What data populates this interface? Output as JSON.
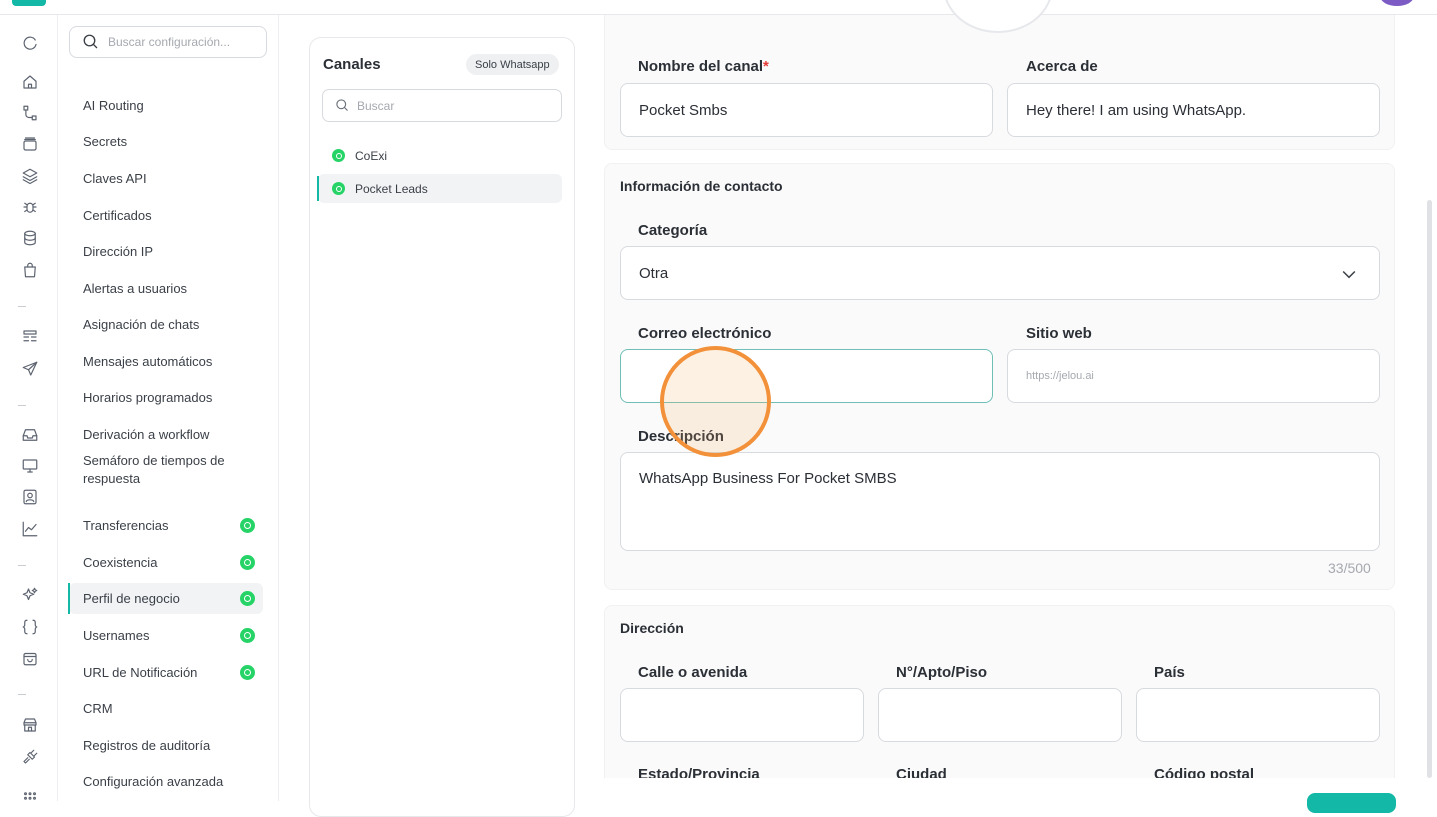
{
  "settings_nav": {
    "search_placeholder": "Buscar configuración...",
    "items": [
      {
        "label": "AI Routing",
        "whatsapp": false
      },
      {
        "label": "Secrets",
        "whatsapp": false
      },
      {
        "label": "Claves API",
        "whatsapp": false
      },
      {
        "label": "Certificados",
        "whatsapp": false
      },
      {
        "label": "Dirección IP",
        "whatsapp": false
      },
      {
        "label": "Alertas a usuarios",
        "whatsapp": false
      },
      {
        "label": "Asignación de chats",
        "whatsapp": false
      },
      {
        "label": "Mensajes automáticos",
        "whatsapp": false
      },
      {
        "label": "Horarios programados",
        "whatsapp": false
      },
      {
        "label": "Derivación a workflow",
        "whatsapp": false
      },
      {
        "label": "Semáforo de tiempos de respuesta",
        "whatsapp": false
      },
      {
        "label": "Transferencias",
        "whatsapp": true
      },
      {
        "label": "Coexistencia",
        "whatsapp": true
      },
      {
        "label": "Perfil de negocio",
        "whatsapp": true,
        "active": true
      },
      {
        "label": "Usernames",
        "whatsapp": true
      },
      {
        "label": "URL de Notificación",
        "whatsapp": true
      },
      {
        "label": "CRM",
        "whatsapp": false
      },
      {
        "label": "Registros de auditoría",
        "whatsapp": false
      },
      {
        "label": "Configuración avanzada",
        "whatsapp": false
      }
    ]
  },
  "channels": {
    "title": "Canales",
    "badge": "Solo Whatsapp",
    "search_placeholder": "Buscar",
    "items": [
      {
        "label": "CoExi"
      },
      {
        "label": "Pocket Leads",
        "active": true
      }
    ]
  },
  "profile": {
    "channel_name_label": "Nombre del canal",
    "required_mark": "*",
    "channel_name_value": "Pocket Smbs",
    "about_label": "Acerca de",
    "about_value": "Hey there! I am using WhatsApp."
  },
  "contact": {
    "title": "Información de contacto",
    "category_label": "Categoría",
    "category_value": "Otra",
    "email_label": "Correo electrónico",
    "email_value": "",
    "website_label": "Sitio web",
    "website_placeholder": "https://jelou.ai",
    "description_label": "Descripción",
    "description_value": "WhatsApp Business For Pocket SMBS",
    "counter": "33/500"
  },
  "address": {
    "title": "Dirección",
    "street_label": "Calle o avenida",
    "apt_label": "N°/Apto/Piso",
    "country_label": "País",
    "state_label": "Estado/Provincia",
    "city_label": "Ciudad",
    "postal_label": "Código postal"
  },
  "colors": {
    "accent": "#14b8a6",
    "whatsapp": "#25d366",
    "cursor_ring": "#f2913a"
  }
}
